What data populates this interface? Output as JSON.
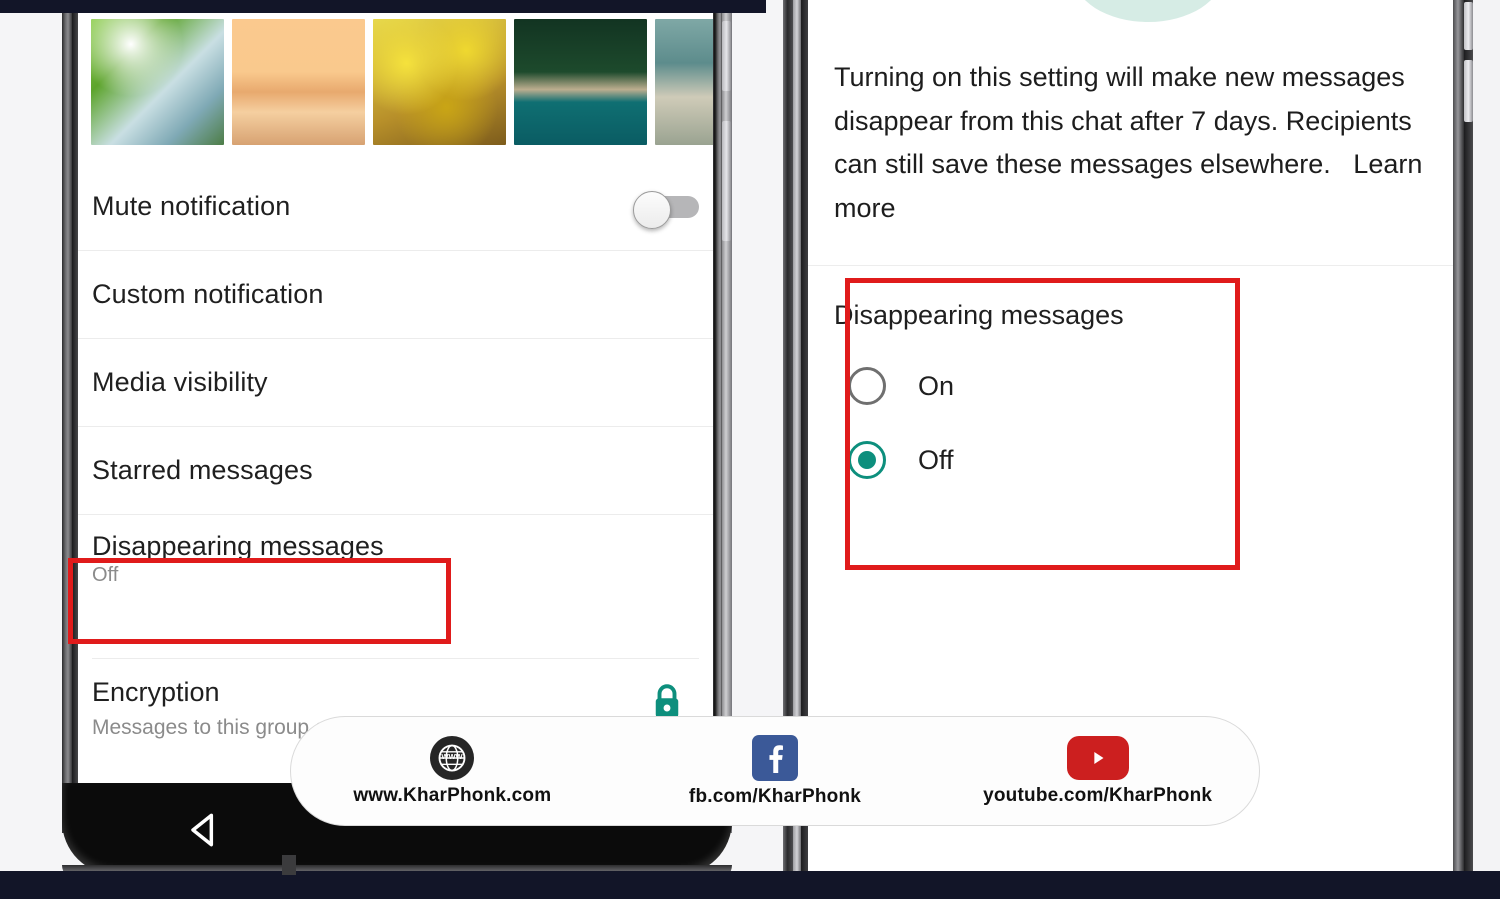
{
  "meta": {
    "app": "WhatsApp group settings - Disappearing messages tutorial",
    "colors": {
      "accent_teal": "#0d8f7d",
      "highlight_red": "#e01b1b",
      "band_navy": "#121528",
      "facebook_blue": "#3b5998",
      "youtube_red": "#cc1f1f",
      "mint_circle": "#d6ece5",
      "toggle_track": "#b6b6b8",
      "subtitle_gray": "#8b8b8b"
    }
  },
  "left_phone": {
    "media_strip": {
      "name": "media-thumbnails",
      "thumbnails": [
        {
          "alt": "palm leaves"
        },
        {
          "alt": "beach sunset"
        },
        {
          "alt": "yellow flowers"
        },
        {
          "alt": "forest lake"
        },
        {
          "alt": "rocky shore"
        }
      ]
    },
    "settings": [
      {
        "title": "Mute notification",
        "subtitle": "",
        "control": "toggle",
        "toggle_state": "off"
      },
      {
        "title": "Custom notification",
        "subtitle": "",
        "control": "none"
      },
      {
        "title": "Media visibility",
        "subtitle": "",
        "control": "none"
      },
      {
        "title": "Starred messages",
        "subtitle": "",
        "control": "none"
      },
      {
        "title": "Disappearing messages",
        "subtitle": "Off",
        "control": "none",
        "highlighted": true
      }
    ],
    "encryption": {
      "title": "Encryption",
      "subtitle": "Messages to this group are secured with end-to-end encryption",
      "icon": "lock-icon"
    },
    "nav": {
      "back_icon": "back-triangle-icon"
    }
  },
  "right_phone": {
    "description": "Turning on this setting will make new messages disappear from this chat after 7 days. Recipients can still save these messages elsewhere.",
    "learn_more": "Learn more",
    "section": {
      "title": "Disappearing messages",
      "options": [
        {
          "label": "On",
          "selected": false
        },
        {
          "label": "Off",
          "selected": true
        }
      ]
    }
  },
  "branding": {
    "items": [
      {
        "icon": "globe-www-icon",
        "text": "www.KharPhonk.com"
      },
      {
        "icon": "facebook-icon",
        "text": "fb.com/KharPhonk"
      },
      {
        "icon": "youtube-icon",
        "text": "youtube.com/KharPhonk"
      }
    ]
  }
}
